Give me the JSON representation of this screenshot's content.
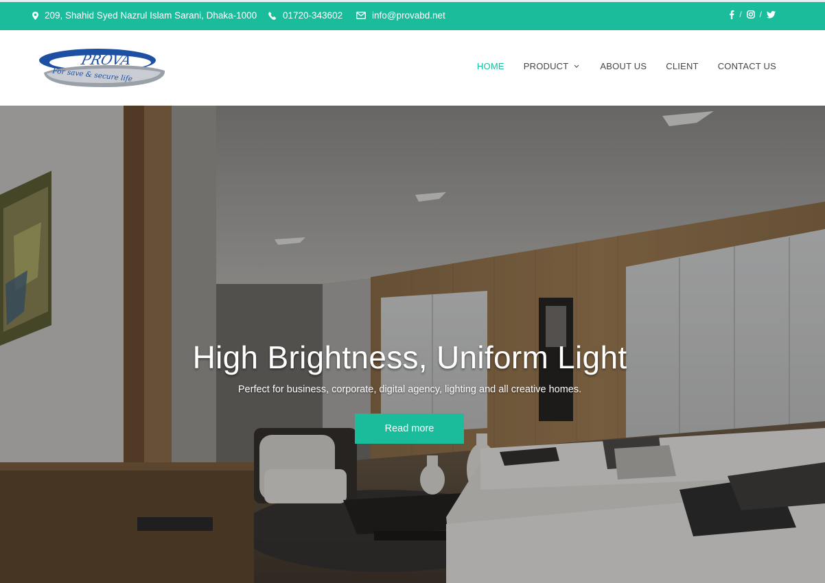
{
  "topbar": {
    "address": "209, Shahid Syed Nazrul Islam Sarani, Dhaka-1000",
    "phone": "01720-343602",
    "email": "info@provabd.net",
    "address_icon": "map-marker-icon",
    "phone_icon": "phone-icon",
    "email_icon": "envelope-icon",
    "social": [
      "facebook-icon",
      "instagram-icon",
      "twitter-icon"
    ],
    "separator": "/"
  },
  "logo": {
    "brand": "PROVA",
    "tagline": "For save & secure life"
  },
  "nav": {
    "items": [
      {
        "label": "HOME",
        "active": true
      },
      {
        "label": "PRODUCT",
        "has_dropdown": true
      },
      {
        "label": "ABOUT US"
      },
      {
        "label": "CLIENT"
      },
      {
        "label": "CONTACT US"
      }
    ]
  },
  "hero": {
    "title": "High Brightness, Uniform Light",
    "subtitle": "Perfect for business, corporate, digital agency, lighting and all creative  homes.",
    "button_label": "Read more"
  },
  "colors": {
    "accent": "#1abc9c",
    "nav_text": "#444444",
    "topbar_text": "#ffffff"
  }
}
